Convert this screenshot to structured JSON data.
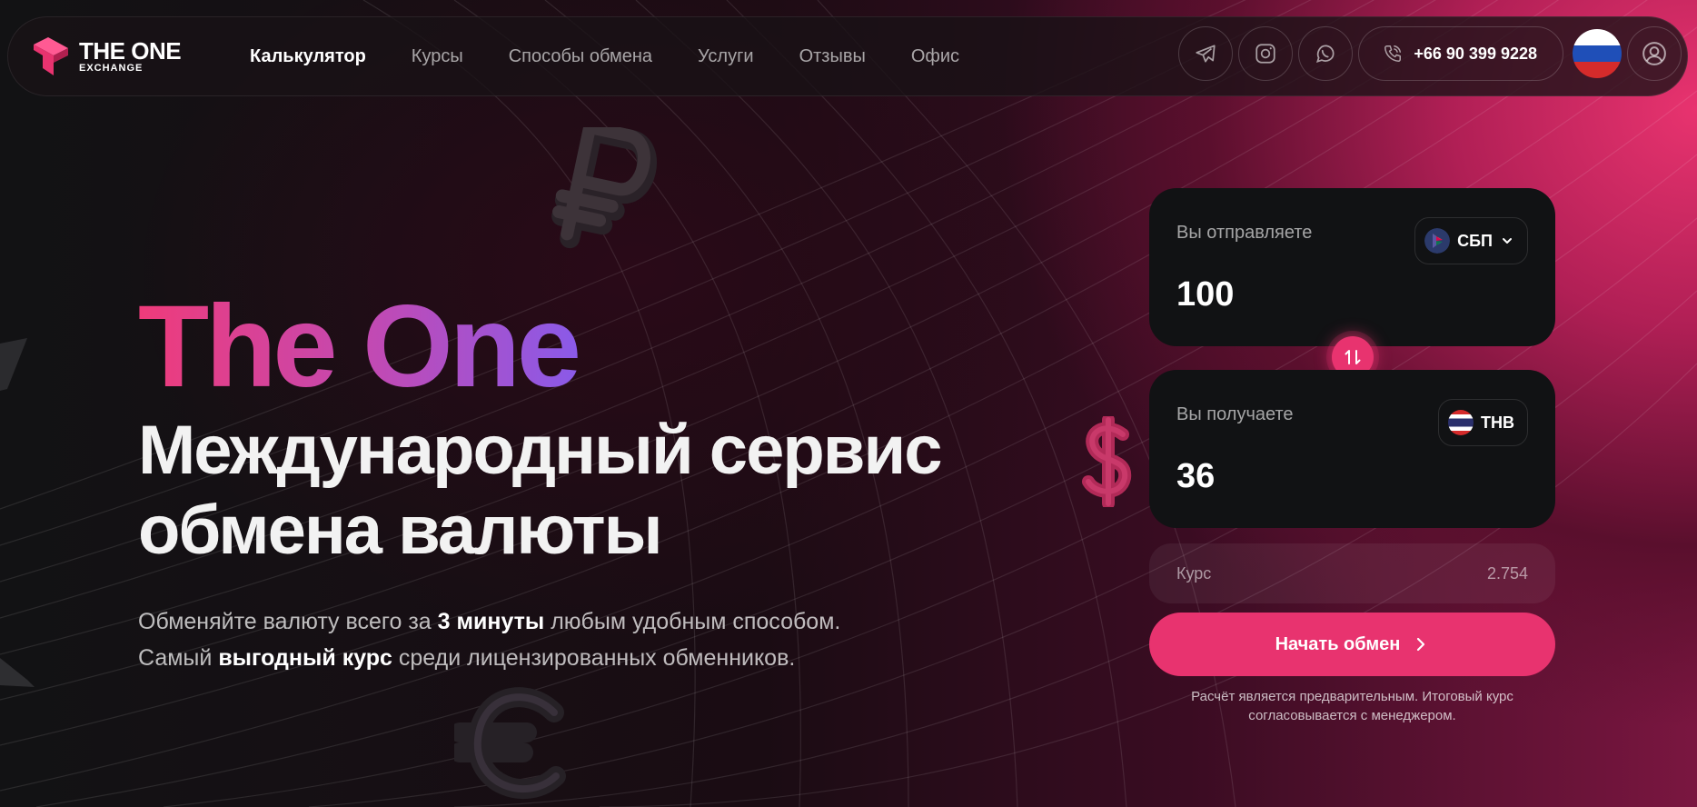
{
  "header": {
    "logo_title": "THE ONE",
    "logo_subtitle": "EXCHANGE",
    "nav": [
      {
        "label": "Калькулятор",
        "active": true
      },
      {
        "label": "Курсы"
      },
      {
        "label": "Способы обмена"
      },
      {
        "label": "Услуги"
      },
      {
        "label": "Отзывы"
      },
      {
        "label": "Офис"
      }
    ],
    "social_icons": [
      "telegram-icon",
      "instagram-icon",
      "whatsapp-icon"
    ],
    "phone": "+66 90 399 9228",
    "language_flag": "russia-flag-icon",
    "account_icon": "user-icon"
  },
  "hero": {
    "brand": "The One",
    "title_line1": "Международный сервис",
    "title_line2": "обмена валюты",
    "subtitle_line1_a": "Обменяйте валюту всего за ",
    "subtitle_line1_b": "3 минуты",
    "subtitle_line1_c": " любым удобным способом.",
    "subtitle_line2_a": "Самый ",
    "subtitle_line2_b": "выгодный курс",
    "subtitle_line2_c": " среди лицензированных обменников."
  },
  "calculator": {
    "send_label": "Вы отправляете",
    "send_value": "100",
    "send_currency": "СБП",
    "receive_label": "Вы получаете",
    "receive_value": "36",
    "receive_currency": "THB",
    "rate_label": "Курс",
    "rate_value": "2.754",
    "start_button": "Начать обмен",
    "disclaimer_line1": "Расчёт является предварительным. Итоговый курс",
    "disclaimer_line2": "согласовывается с менеджером."
  },
  "colors": {
    "accent": "#e8336f",
    "card": "#111214",
    "brand_gradient_start": "#ef3b7a",
    "brand_gradient_end": "#8a5ae8"
  }
}
